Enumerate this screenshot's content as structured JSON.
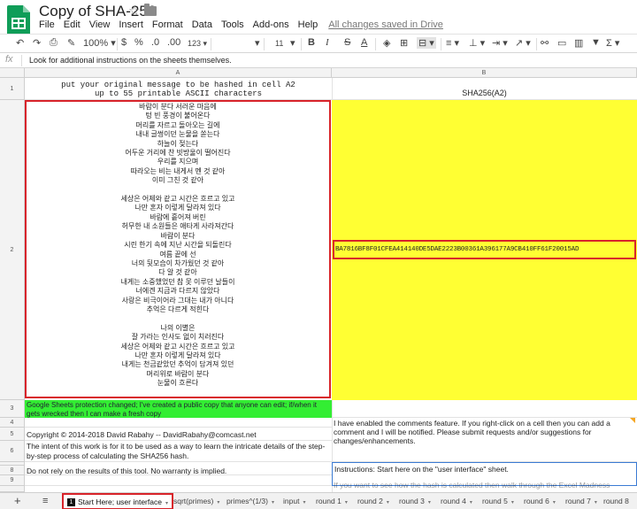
{
  "app": {
    "title": "Copy of SHA-256",
    "star_icon": "star-outline-icon",
    "folder_icon": "folder-icon",
    "menu": [
      "File",
      "Edit",
      "View",
      "Insert",
      "Format",
      "Data",
      "Tools",
      "Add-ons",
      "Help"
    ],
    "save_status": "All changes saved in Drive"
  },
  "toolbar": {
    "zoom": "100%",
    "currency": "$",
    "percent": "%",
    "decimal_less": ".0",
    "decimal_more": ".00",
    "number_format": "123",
    "font_size": "11",
    "bold": "B",
    "italic": "I",
    "strike": "S",
    "text_color": "A"
  },
  "formula_bar": {
    "fx_label": "fx",
    "content": "Look for additional instructions on the sheets themselves."
  },
  "grid": {
    "col_a": "A",
    "col_b": "B",
    "rows": [
      "1",
      "2",
      "3",
      "4",
      "5",
      "6",
      "7",
      "8",
      "9"
    ],
    "a1": "put your original message to be hashed in cell A2\nup to 55 printable ASCII characters",
    "b1": "SHA256(A2)",
    "a2": "바람이 분다 서러운 마음에\n텅 빈 풍경이 불어온다\n머리를 자르고 돌아오는 길에\n내내 글썽이던 눈물을 쏟는다\n하늘이 젖는다\n어두운 거리에 찬 빗방울이 떨어진다\n우리를 지으며\n따라오는 비는 내게서 멘 것 같아\n이미 그친 것 같아\n\n세상은 어제와 같고 시간은 흐르고 있고\n나만 혼자 이렇게 달라져 있다\n바람에 흩어져 버린\n허무한 내 소원들은 애타게 사라져간다\n바람이 분다\n시린 한기 속에 지난 시간을 되돌린다\n여름 끝에 선\n너의 뒷모습이 차가웠던 것 같아\n다 알 것 같아\n내게는 소중했었던 참 못 이루던 날들이\n너에겐 지금과 다르지 않았다\n사랑은 비극이어라 그대는 내가 아니다\n추억은 다르게 적힌다\n\n나의 이별은\n잘 가라는 인사도 없이 치러진다\n세상은 어제와 같고 시간은 흐르고 있고\n나만 혼자 이렇게 달라져 있다\n내게는 천금같았던 추억이 담겨져 있던\n머리위로 바람이 분다\n눈물이 흐른다",
    "b2": "BA7816BF8F01CFEA414140DE5DAE2223B00361A396177A9CB410FF61F20015AD",
    "a3": "Google Sheets protection changed; I've created a public copy that anyone can edit; if/when it gets wrecked then I can make a fresh copy",
    "a5": "Copyright © 2014-2018 David Rabahy -- DavidRabahy@comcast.net",
    "a6": "The intent of this work is for it to be used as a way to learn the intricate details of the step-by-step process of calculating the SHA256 hash.",
    "a8": "Do not rely on the results of this tool.  No warranty is implied.",
    "b_comments": "I have enabled the comments feature.  If you right-click on a cell then you can add a comment and I will be notified.  Please submit requests and/or suggestions for changes/enhancements.",
    "b_instructions": "Instructions:  Start here on the \"user interface\" sheet.",
    "b_instructions_more": "If you want to see how the hash is calculated then walk through the Excel Madness"
  },
  "sheets": {
    "add_icon": "plus-icon",
    "list_icon": "menu-icon",
    "active_badge": "1",
    "tabs": [
      "Start Here; user interface",
      "sqrt(primes)",
      "primes^(1/3)",
      "input",
      "round 1",
      "round 2",
      "round 3",
      "round 4",
      "round 5",
      "round 6",
      "round 7",
      "round 8"
    ]
  },
  "colors": {
    "accent_red": "#d8232a",
    "yellow_fill": "#ffff33",
    "green_fill": "#33ee33",
    "selection_blue": "#3b7bd4",
    "logo_green": "#0f9d58"
  }
}
